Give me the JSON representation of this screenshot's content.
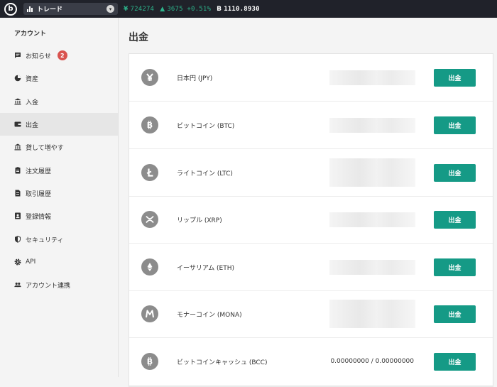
{
  "topbar": {
    "trade_label": "トレード",
    "jpy_symbol": "¥",
    "jpy_value": "724274",
    "change_arrow": "▲",
    "change_value": "3675 +0.51%",
    "btc_symbol": "B",
    "btc_value": "1110.8930"
  },
  "sidebar": {
    "heading": "アカウント",
    "items": [
      {
        "label": "お知らせ",
        "icon": "message-icon",
        "badge": "2"
      },
      {
        "label": "資産",
        "icon": "pie-chart-icon"
      },
      {
        "label": "入金",
        "icon": "bank-icon"
      },
      {
        "label": "出金",
        "icon": "wallet-icon",
        "active": true
      },
      {
        "label": "貸して増やす",
        "icon": "bank-icon"
      },
      {
        "label": "注文履歴",
        "icon": "clipboard-icon"
      },
      {
        "label": "取引履歴",
        "icon": "document-icon"
      },
      {
        "label": "登録情報",
        "icon": "id-card-icon"
      },
      {
        "label": "セキュリティ",
        "icon": "shield-icon"
      },
      {
        "label": "API",
        "icon": "gear-icon"
      },
      {
        "label": "アカウント連携",
        "icon": "people-icon"
      }
    ]
  },
  "main": {
    "title": "出金",
    "withdraw_label": "出金",
    "coins": [
      {
        "name": "日本円 (JPY)",
        "icon": "yen-icon",
        "glyph": "¥"
      },
      {
        "name": "ビットコイン (BTC)",
        "icon": "bitcoin-icon",
        "glyph": "B"
      },
      {
        "name": "ライトコイン (LTC)",
        "icon": "litecoin-icon",
        "glyph": "Ł"
      },
      {
        "name": "リップル (XRP)",
        "icon": "ripple-icon",
        "glyph": "✕"
      },
      {
        "name": "イーサリアム (ETH)",
        "icon": "ethereum-icon",
        "glyph": "◆"
      },
      {
        "name": "モナーコイン (MONA)",
        "icon": "monacoin-icon",
        "glyph": "M"
      },
      {
        "name": "ビットコインキャッシュ (BCC)",
        "icon": "bitcoin-cash-icon",
        "glyph": "B",
        "balance": "0.00000000 / 0.00000000"
      }
    ]
  },
  "colors": {
    "topbar_bg": "#20222a",
    "accent_green": "#159a86",
    "ticker_green": "#2db38b",
    "badge_red": "#d9534f",
    "coin_icon_gray": "#8c8c8c"
  }
}
